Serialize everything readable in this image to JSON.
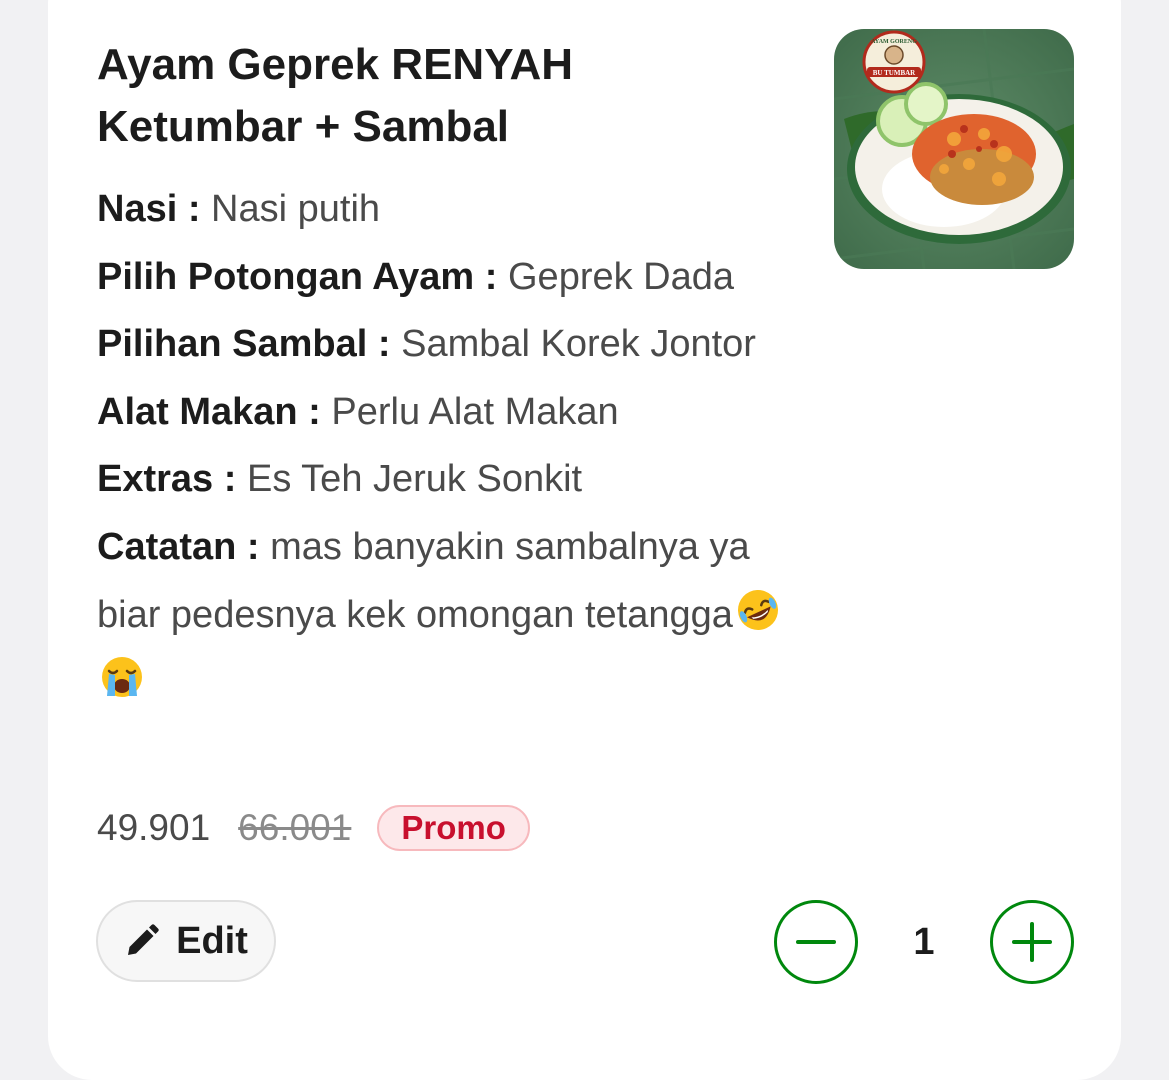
{
  "item": {
    "title": "Ayam Geprek RENYAH Ketumbar + Sambal",
    "image": {
      "icon": "food-photo",
      "brand_top": "AYAM GORENG",
      "brand_name": "BU TUMBAR"
    },
    "details": [
      {
        "key": "Nasi :",
        "value": "Nasi putih"
      },
      {
        "key": "Pilih Potongan Ayam :",
        "value": "Geprek Dada"
      },
      {
        "key": "Pilihan Sambal :",
        "value": "Sambal Korek Jontor"
      },
      {
        "key": "Alat Makan :",
        "value": "Perlu Alat Makan"
      },
      {
        "key": "Extras :",
        "value": "Es Teh Jeruk Sonkit"
      },
      {
        "key": "Catatan :",
        "value": "mas banyakin sambalnya ya biar pedesnya kek omongan tetangga",
        "emojis": [
          "rolling-on-floor-laughing-emoji",
          "loudly-crying-emoji"
        ]
      }
    ],
    "price": {
      "current": "49.901",
      "original": "66.001",
      "badge": "Promo"
    }
  },
  "actions": {
    "edit_label": "Edit",
    "edit_icon": "pencil-icon",
    "quantity": "1",
    "decrease_icon": "minus-icon",
    "increase_icon": "plus-icon"
  },
  "colors": {
    "accent_green": "#00880d",
    "promo_red": "#c8102e",
    "promo_bg": "#fde8ea",
    "text_primary": "#1c1c1c",
    "text_secondary": "#4a4a4a",
    "page_bg": "#f1f1f3"
  }
}
